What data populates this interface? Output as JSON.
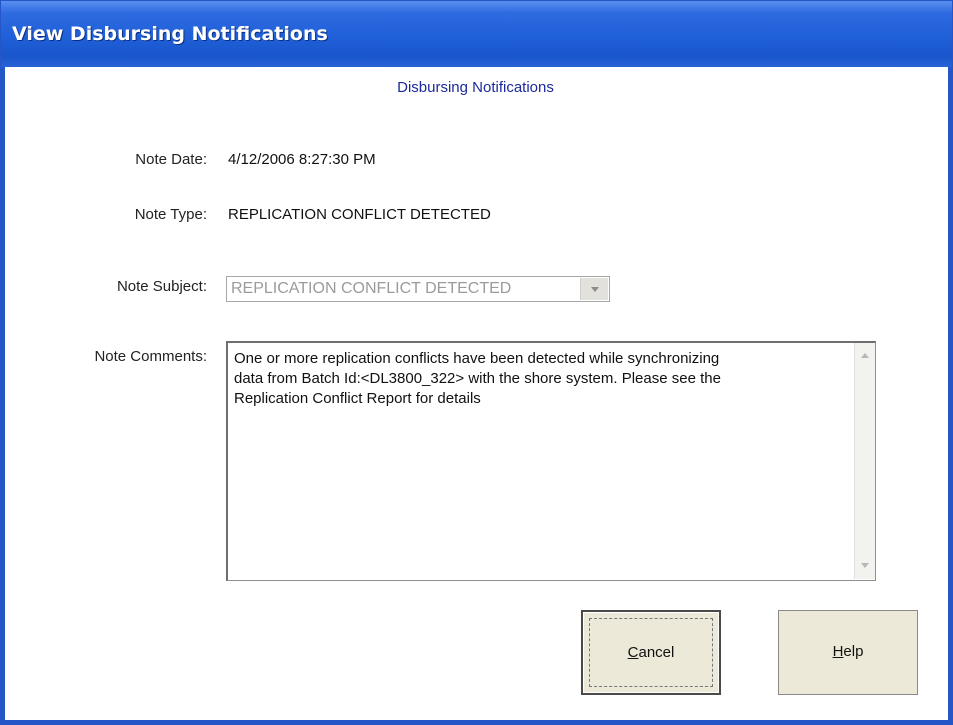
{
  "window": {
    "title": "View Disbursing Notifications",
    "heading": "Disbursing Notifications",
    "accent_color": "#1f5fd8",
    "heading_color": "#1c2a9c"
  },
  "form": {
    "note_date": {
      "label": "Note Date:",
      "value": "4/12/2006 8:27:30 PM"
    },
    "note_type": {
      "label": "Note Type:",
      "value": "REPLICATION CONFLICT DETECTED"
    },
    "note_subject": {
      "label": "Note Subject:",
      "value": "REPLICATION CONFLICT DETECTED",
      "disabled": true,
      "icon": "chevron-down-icon"
    },
    "note_comments": {
      "label": "Note Comments:",
      "value": "One or more replication conflicts have been detected while synchronizing\ndata from Batch Id:<DL3800_322> with the shore system. Please see the\nReplication Conflict Report for details"
    }
  },
  "buttons": {
    "cancel": {
      "mnemonic": "C",
      "rest": "ancel"
    },
    "help": {
      "mnemonic": "H",
      "rest": "elp"
    }
  }
}
